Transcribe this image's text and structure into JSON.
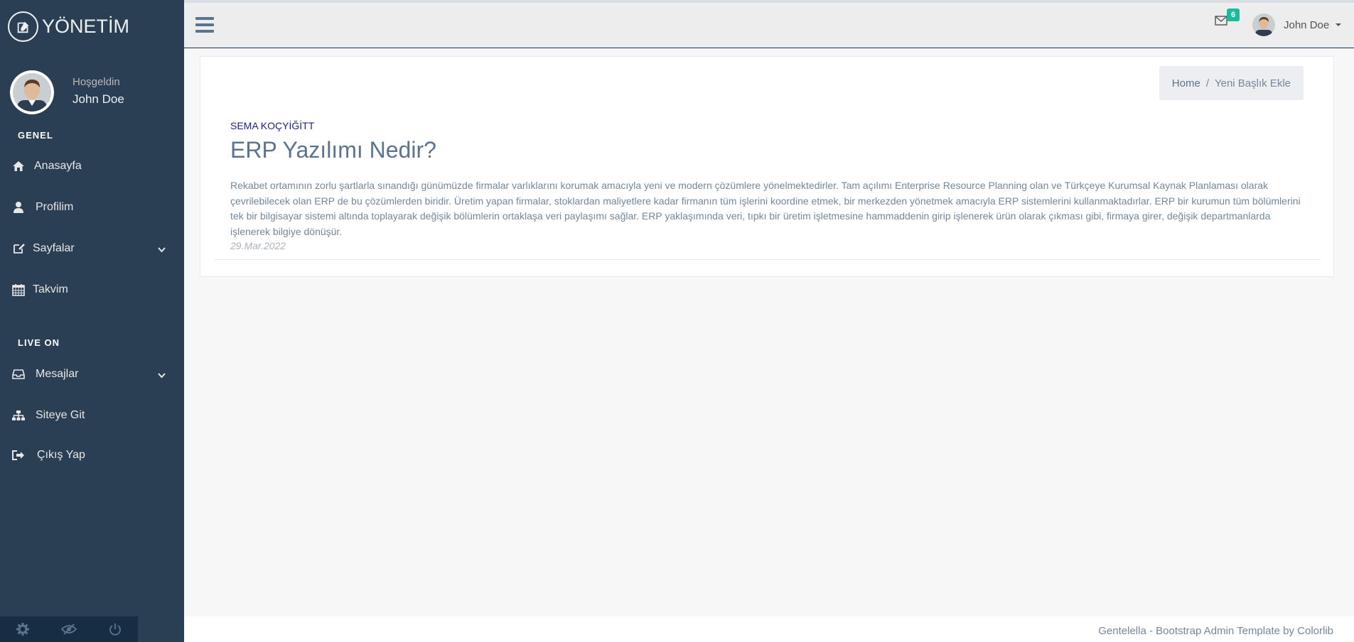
{
  "brand": {
    "title": "YÖNETİM"
  },
  "profile": {
    "welcome": "Hoşgeldin",
    "name": "John Doe"
  },
  "sidebar": {
    "section_general": "GENEL",
    "section_live": "LIVE ON",
    "items_general": [
      {
        "label": "Anasayfa",
        "icon": "home-icon"
      },
      {
        "label": "Profilim",
        "icon": "user-icon"
      },
      {
        "label": "Sayfalar",
        "icon": "edit-icon",
        "has_chevron": true
      },
      {
        "label": "Takvim",
        "icon": "calendar-icon"
      }
    ],
    "items_live": [
      {
        "label": "Mesajlar",
        "icon": "inbox-icon",
        "has_chevron": true
      },
      {
        "label": "Siteye Git",
        "icon": "sitemap-icon"
      },
      {
        "label": "Çıkış Yap",
        "icon": "sign-out-icon"
      }
    ],
    "footer_icons": [
      "settings-icon",
      "eye-slash-icon",
      "power-icon"
    ]
  },
  "topnav": {
    "mail_count": "6",
    "user_name": "John Doe"
  },
  "breadcrumb": {
    "home": "Home",
    "sep": "/",
    "current": "Yeni Başlık Ekle"
  },
  "post": {
    "author": "SEMA KOÇYİĞİTT",
    "title": "ERP Yazılımı Nedir?",
    "body": "Rekabet ortamının zorlu şartlarla sınandığı günümüzde firmalar varlıklarını korumak amacıyla yeni ve modern çözümlere yönelmektedirler. Tam açılımı Enterprise Resource Planning olan ve Türkçeye Kurumsal Kaynak Planlaması olarak çevrilebilecek olan ERP de bu çözümlerden biridir. Üretim yapan firmalar, stoklardan maliyetlere kadar firmanın tüm işlerini koordine etmek, bir merkezden yönetmek amacıyla ERP sistemlerini kullanmaktadırlar. ERP bir kurumun tüm bölümlerini tek bir bilgisayar sistemi altında toplayarak değişik bölümlerin ortaklaşa veri paylaşımı sağlar. ERP yaklaşımında veri, tıpkı bir üretim işletmesine hammaddenin girip işlenerek ürün olarak çıkması gibi, firmaya girer, değişik departmanlarda işlenerek bilgiye dönüşür.",
    "date": "29.Mar.2022"
  },
  "footer": {
    "text": "Gentelella - Bootstrap Admin Template by Colorlib"
  },
  "colors": {
    "sidebar": "#2A3F54",
    "accent": "#1ABB9C",
    "text": "#73879C"
  }
}
